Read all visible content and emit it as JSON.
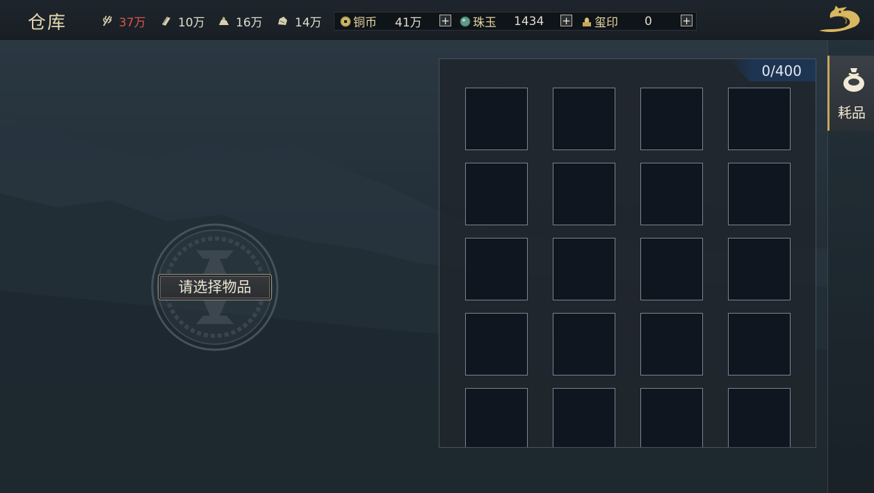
{
  "header": {
    "title": "仓库",
    "resources": [
      {
        "icon": "grain-icon",
        "value": "37万",
        "warning": true
      },
      {
        "icon": "wood-icon",
        "value": "10万",
        "warning": false
      },
      {
        "icon": "stone-icon",
        "value": "16万",
        "warning": false
      },
      {
        "icon": "iron-icon",
        "value": "14万",
        "warning": false
      }
    ],
    "currencies": [
      {
        "icon": "copper-coin-icon",
        "name": "铜币",
        "value": "41万"
      },
      {
        "icon": "jade-icon",
        "name": "珠玉",
        "value": "1434"
      },
      {
        "icon": "seal-icon",
        "name": "玺印",
        "value": "0"
      }
    ],
    "plus_label": "+"
  },
  "side_tabs": [
    {
      "icon": "pouch-icon",
      "label": "耗品",
      "active": true
    }
  ],
  "detail": {
    "placeholder": "请选择物品"
  },
  "inventory": {
    "capacity": "0/400",
    "slot_rows": 5,
    "slot_cols": 4
  },
  "colors": {
    "accent_gold": "#c9a75a",
    "warning_red": "#d9544d",
    "capacity_blue": "#1d3553"
  }
}
